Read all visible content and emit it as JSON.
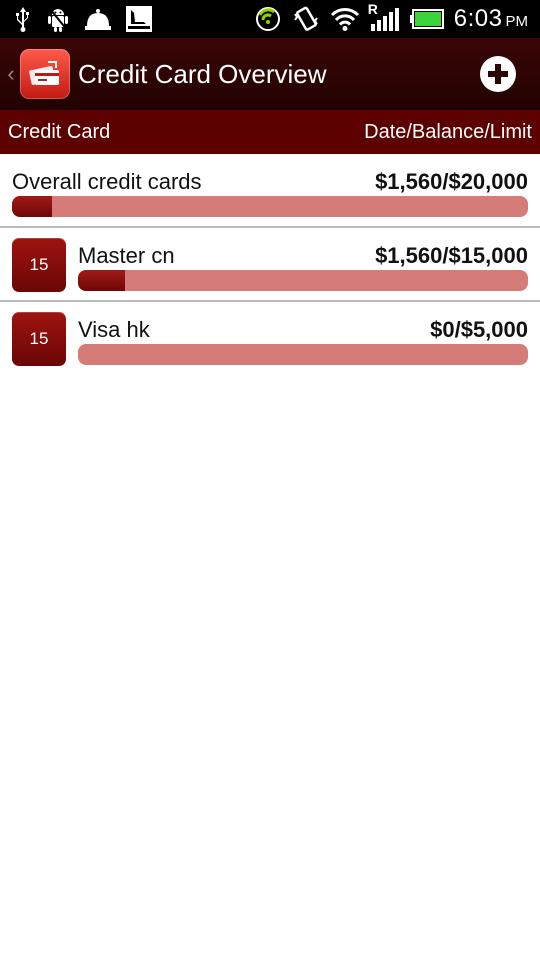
{
  "status_bar": {
    "time": "6:03",
    "ampm": "PM",
    "icons": [
      "usb-icon",
      "android-debug-icon",
      "bell-icon",
      "sailboat-icon",
      "sync-icon",
      "vibrate-icon",
      "wifi-icon",
      "signal-roaming-icon",
      "battery-icon"
    ],
    "roaming_label": "R"
  },
  "header": {
    "back_glyph": "‹",
    "title": "Credit Card Overview",
    "add_icon": "plus-circle-icon"
  },
  "columns": {
    "left": "Credit Card",
    "right": "Date/Balance/Limit"
  },
  "overall": {
    "name": "Overall credit cards",
    "amount": "$1,560/$20,000",
    "progress": 0.078
  },
  "cards": [
    {
      "date": "15",
      "name": "Master cn",
      "amount": "$1,560/$15,000",
      "progress": 0.104
    },
    {
      "date": "15",
      "name": "Visa hk",
      "amount": "$0/$5,000",
      "progress": 0.0
    }
  ],
  "colors": {
    "header_dark": "#2a0303",
    "column_header": "#5c0000",
    "bar_track": "#d57b78",
    "bar_fill": "#8a0e0c",
    "battery_green": "#3ad43a",
    "sync_green": "#8fd400"
  }
}
